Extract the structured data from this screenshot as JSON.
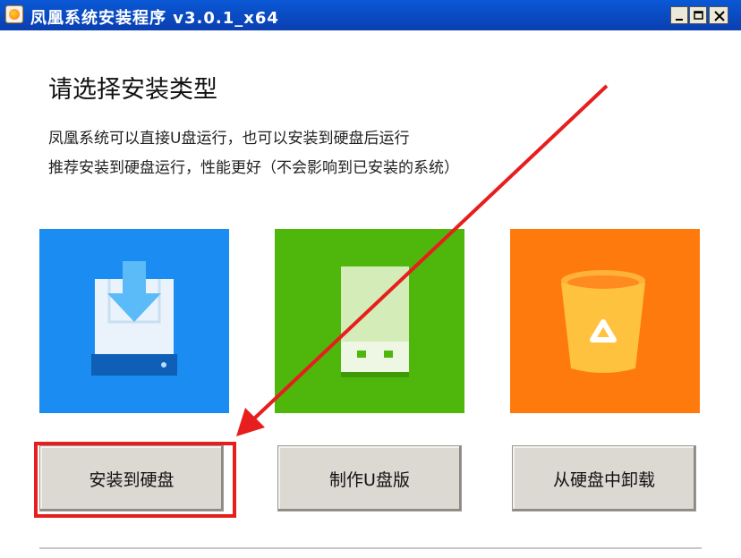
{
  "window": {
    "title": "凤凰系统安装程序 v3.0.1_x64"
  },
  "content": {
    "heading": "请选择安装类型",
    "description_line1": "凤凰系统可以直接U盘运行，也可以安装到硬盘后运行",
    "description_line2": "推荐安装到硬盘运行，性能更好（不会影响到已安装的系统）"
  },
  "options": [
    {
      "icon": "hard-disk-download-icon",
      "color": "#1a8cf2",
      "label": "安装到硬盘"
    },
    {
      "icon": "usb-drive-icon",
      "color": "#4fb70b",
      "label": "制作U盘版"
    },
    {
      "icon": "recycle-bin-icon",
      "color": "#ff7a0c",
      "label": "从硬盘中卸载"
    }
  ],
  "annotation": {
    "highlight_color": "#e61e1e"
  }
}
